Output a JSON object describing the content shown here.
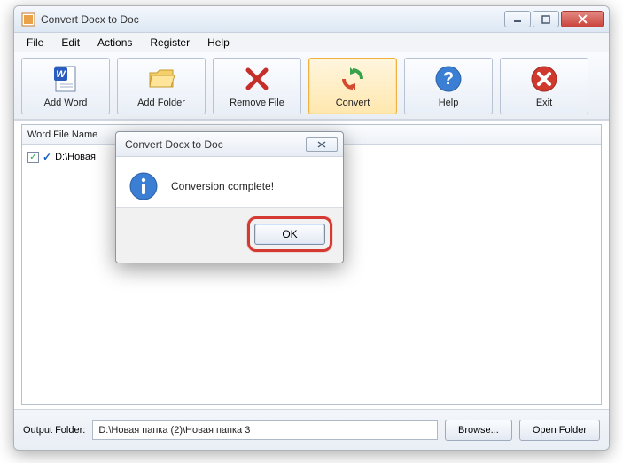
{
  "window": {
    "title": "Convert Docx to Doc"
  },
  "menu": {
    "items": [
      "File",
      "Edit",
      "Actions",
      "Register",
      "Help"
    ]
  },
  "toolbar": {
    "add_word": "Add Word",
    "add_folder": "Add Folder",
    "remove_file": "Remove File",
    "convert": "Convert",
    "help": "Help",
    "exit": "Exit"
  },
  "list": {
    "header": "Word File Name",
    "rows": [
      {
        "checked": true,
        "path": "D:\\Новая"
      }
    ]
  },
  "output": {
    "label": "Output Folder:",
    "path": "D:\\Новая папка (2)\\Новая папка 3",
    "browse": "Browse...",
    "open": "Open Folder"
  },
  "dialog": {
    "title": "Convert Docx to Doc",
    "message": "Conversion complete!",
    "ok": "OK"
  },
  "icons": {
    "info": "info-icon"
  }
}
